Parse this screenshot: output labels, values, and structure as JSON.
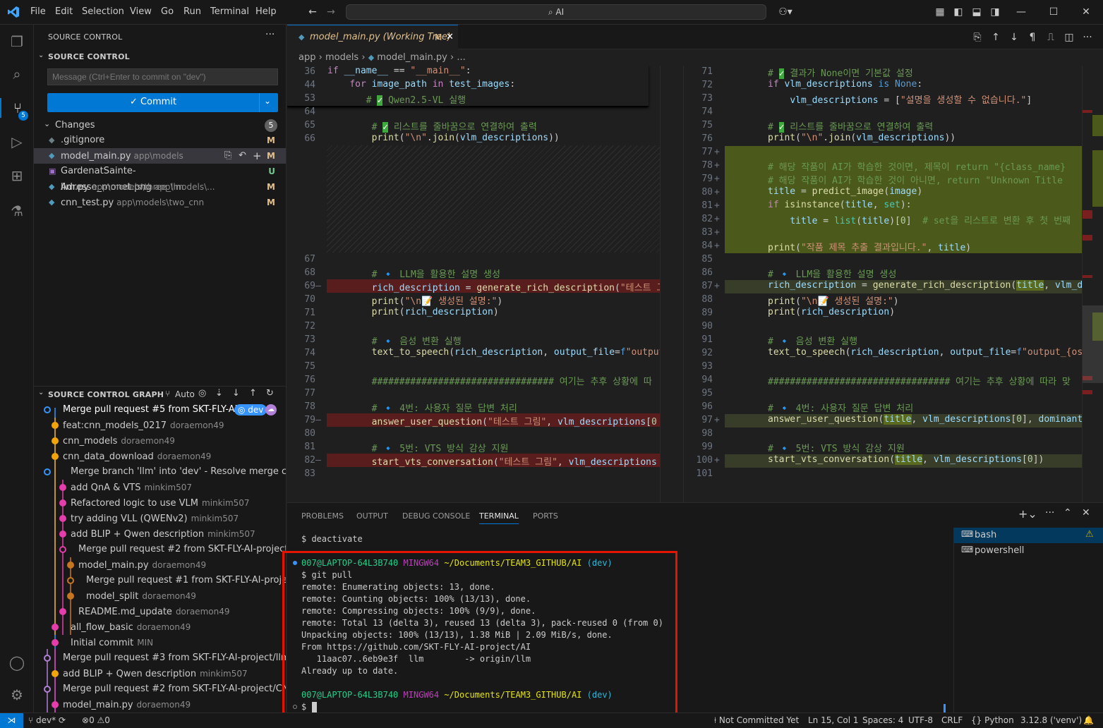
{
  "menu": [
    "File",
    "Edit",
    "Selection",
    "View",
    "Go",
    "Run",
    "Terminal",
    "Help"
  ],
  "search": {
    "text": "AI"
  },
  "sidebar": {
    "title": "SOURCE CONTROL",
    "section": "SOURCE CONTROL",
    "message_placeholder": "Message (Ctrl+Enter to commit on \"dev\")",
    "commit_label": "✓ Commit",
    "changes_label": "Changes",
    "changes_count": "5",
    "files": [
      {
        "name": ".gitignore",
        "path": "",
        "status": "M"
      },
      {
        "name": "model_main.py",
        "path": "app\\models",
        "status": "M"
      },
      {
        "name": "GardenatSainte-Adresse_monet.png",
        "path": "app\\models\\...",
        "status": "U"
      },
      {
        "name": "llm.py",
        "path": "app\\models\\three_llm",
        "status": "M"
      },
      {
        "name": "cnn_test.py",
        "path": "app\\models\\two_cnn",
        "status": "M"
      }
    ],
    "graph_title": "SOURCE CONTROL GRAPH",
    "graph_auto": "Auto",
    "graph": [
      {
        "msg": "Merge pull request #5 from SKT-FLY-AI...",
        "author": "",
        "badge": "dev",
        "bold": true
      },
      {
        "msg": "feat:cnn_models_0217",
        "author": "doraemon49"
      },
      {
        "msg": "cnn_models",
        "author": "doraemon49"
      },
      {
        "msg": "cnn_data_download",
        "author": "doraemon49"
      },
      {
        "msg": "Merge branch 'llm' into 'dev' - Resolve merge co...",
        "author": ""
      },
      {
        "msg": "add QnA & VTS",
        "author": "minkim507"
      },
      {
        "msg": "Refactored logic to use VLM",
        "author": "minkim507"
      },
      {
        "msg": "try adding VLL (QWENv2)",
        "author": "minkim507"
      },
      {
        "msg": "add BLIP + Qwen description",
        "author": "minkim507"
      },
      {
        "msg": "Merge pull request #2 from SKT-FLY-AI-project...",
        "author": ""
      },
      {
        "msg": "model_main.py",
        "author": "doraemon49"
      },
      {
        "msg": "Merge pull request #1 from SKT-FLY-AI-proje...",
        "author": ""
      },
      {
        "msg": "model_split",
        "author": "doraemon49"
      },
      {
        "msg": "README.md_update",
        "author": "doraemon49"
      },
      {
        "msg": "all_flow_basic",
        "author": "doraemon49"
      },
      {
        "msg": "Initial commit",
        "author": "MIN"
      },
      {
        "msg": "Merge pull request #3 from SKT-FLY-AI-project/llm...",
        "author": ""
      },
      {
        "msg": "add BLIP + Qwen description",
        "author": "minkim507"
      },
      {
        "msg": "Merge pull request #2 from SKT-FLY-AI-project/CN...",
        "author": ""
      },
      {
        "msg": "model_main.py",
        "author": "doraemon49"
      }
    ]
  },
  "editor": {
    "tab_label": "model_main.py (Working Tree)",
    "tab_status": "M",
    "breadcrumb": [
      "app",
      "models",
      "model_main.py",
      "..."
    ]
  },
  "left_lines": [
    "36",
    "44",
    "53",
    "64",
    "65",
    "66",
    "67",
    "68",
    "69",
    "70",
    "71",
    "72",
    "73",
    "74",
    "75",
    "76",
    "77",
    "78",
    "79",
    "80",
    "81",
    "82",
    "83"
  ],
  "right_lines": [
    "71",
    "72",
    "73",
    "74",
    "75",
    "76",
    "77",
    "78",
    "79",
    "80",
    "81",
    "82",
    "83",
    "84",
    "85",
    "86",
    "87",
    "88",
    "89",
    "90",
    "91",
    "92",
    "93",
    "94",
    "95",
    "96",
    "97",
    "98",
    "99",
    "100",
    "101"
  ],
  "panel": {
    "tabs": [
      "PROBLEMS",
      "OUTPUT",
      "DEBUG CONSOLE",
      "TERMINAL",
      "PORTS"
    ],
    "active_tab": "TERMINAL",
    "terminals": [
      "bash",
      "powershell"
    ],
    "prev_cmd": "$ deactivate",
    "prompt_user": "007@LAPTOP-64L3B740",
    "prompt_env": "MINGW64",
    "prompt_path": "~/Documents/TEAM3_GITHUB/AI",
    "prompt_branch": "(dev)",
    "output": [
      "$ git pull",
      "remote: Enumerating objects: 13, done.",
      "remote: Counting objects: 100% (13/13), done.",
      "remote: Compressing objects: 100% (9/9), done.",
      "remote: Total 13 (delta 3), reused 13 (delta 3), pack-reused 0 (from 0)",
      "Unpacking objects: 100% (13/13), 1.38 MiB | 2.09 MiB/s, done.",
      "From https://github.com/SKT-FLY-AI-project/AI",
      "   11aac07..6eb9e3f  llm        -> origin/llm",
      "Already up to date."
    ],
    "last_prompt": "$"
  },
  "status": {
    "branch": "dev*",
    "errors": "0",
    "warnings": "0",
    "blame": "Not Committed Yet",
    "position": "Ln 15, Col 1",
    "spaces": "Spaces: 4",
    "encoding": "UTF-8",
    "eol": "CRLF",
    "language": "Python",
    "interpreter": "3.12.8 ('venv')"
  },
  "colors": {
    "accent": "#0078d4",
    "added": "#4b5a1a",
    "removed": "#5a1d1d",
    "highlight_red": "#e51400"
  }
}
